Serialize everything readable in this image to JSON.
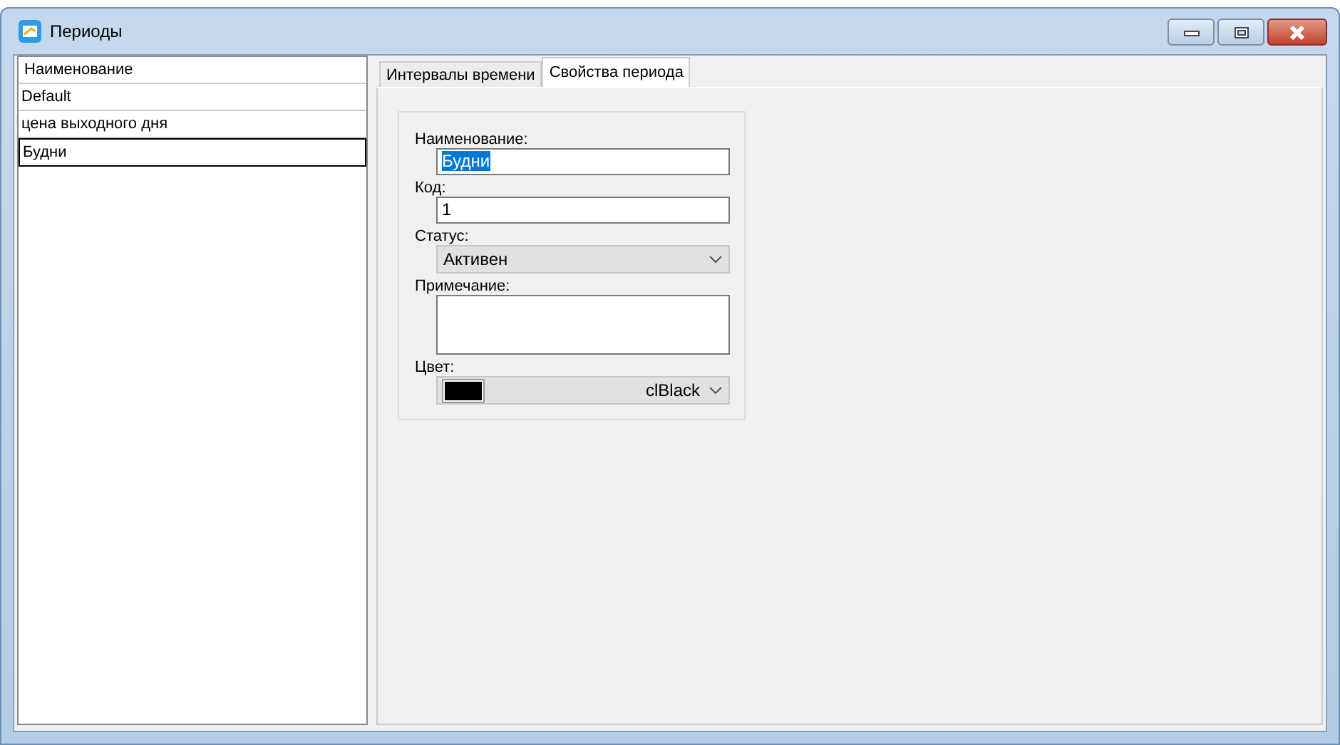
{
  "window": {
    "title": "Периоды"
  },
  "list": {
    "header": "Наименование",
    "rows": [
      {
        "label": "Default",
        "selected": false
      },
      {
        "label": "цена выходного дня",
        "selected": false
      },
      {
        "label": "Будни",
        "selected": true
      }
    ]
  },
  "tabs": [
    {
      "label": "Интервалы времени",
      "selected": false
    },
    {
      "label": "Свойства периода",
      "selected": true
    }
  ],
  "form": {
    "name_label": "Наименование:",
    "name_value": "Будни",
    "code_label": "Код:",
    "code_value": "1",
    "status_label": "Статус:",
    "status_value": "Активен",
    "note_label": "Примечание:",
    "color_label": "Цвет:",
    "color_value": "clBlack",
    "color": "#000000"
  }
}
